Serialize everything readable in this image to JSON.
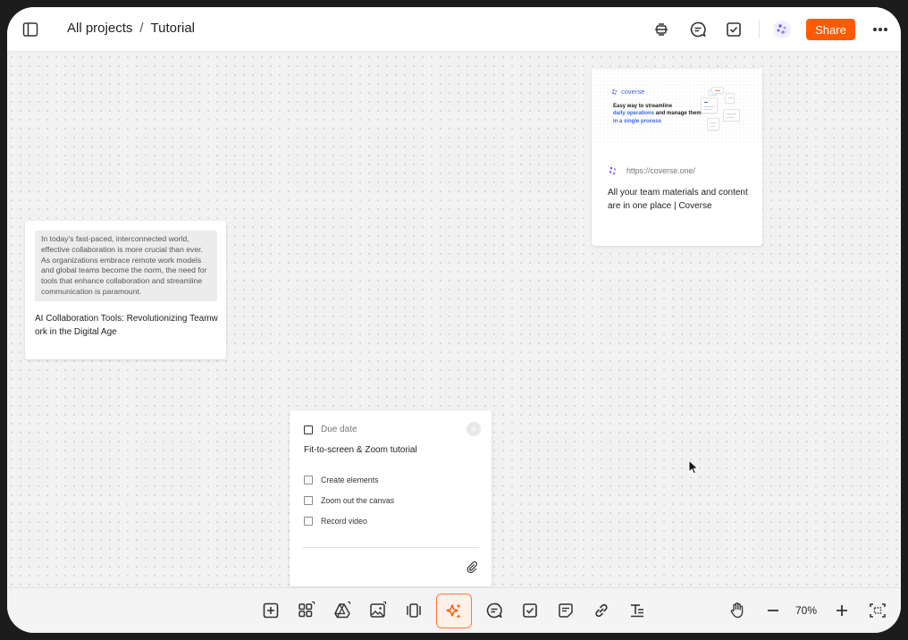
{
  "header": {
    "breadcrumb": {
      "root": "All projects",
      "separator": "/",
      "current": "Tutorial"
    },
    "share_label": "Share",
    "accent": "#ff5a00"
  },
  "canvas": {
    "article_card": {
      "excerpt": "In today's fast-paced, interconnected world, effective collaboration is more crucial than ever. As organizations embrace remote work models and global teams become the norm, the need for tools that enhance collaboration and streamline communication is paramount.",
      "title": "AI Collaboration Tools: Revolutionizing Teamwork in the Digital Age"
    },
    "link_card": {
      "preview": {
        "brand": "coverse",
        "tagline_1": "Easy way to streamline",
        "tagline_2": "daily operations",
        "tagline_3": " and manage them ",
        "tagline_4": "in a single process"
      },
      "url": "https://coverse.one/",
      "title": "All your team materials and content are in one place | Coverse"
    },
    "task_card": {
      "due_label": "Due date",
      "title": "Fit-to-screen & Zoom tutorial",
      "items": [
        {
          "label": "Create elements",
          "checked": false
        },
        {
          "label": "Zoom out the canvas",
          "checked": false
        },
        {
          "label": "Record video",
          "checked": false
        }
      ]
    }
  },
  "toolbar": {
    "zoom_level": "70%",
    "tools": [
      "add-element-icon",
      "apps-grid-icon",
      "google-drive-icon",
      "image-icon",
      "slides-icon",
      "ai-sparkle-icon",
      "comment-icon",
      "task-icon",
      "note-icon",
      "link-icon",
      "text-icon"
    ]
  }
}
